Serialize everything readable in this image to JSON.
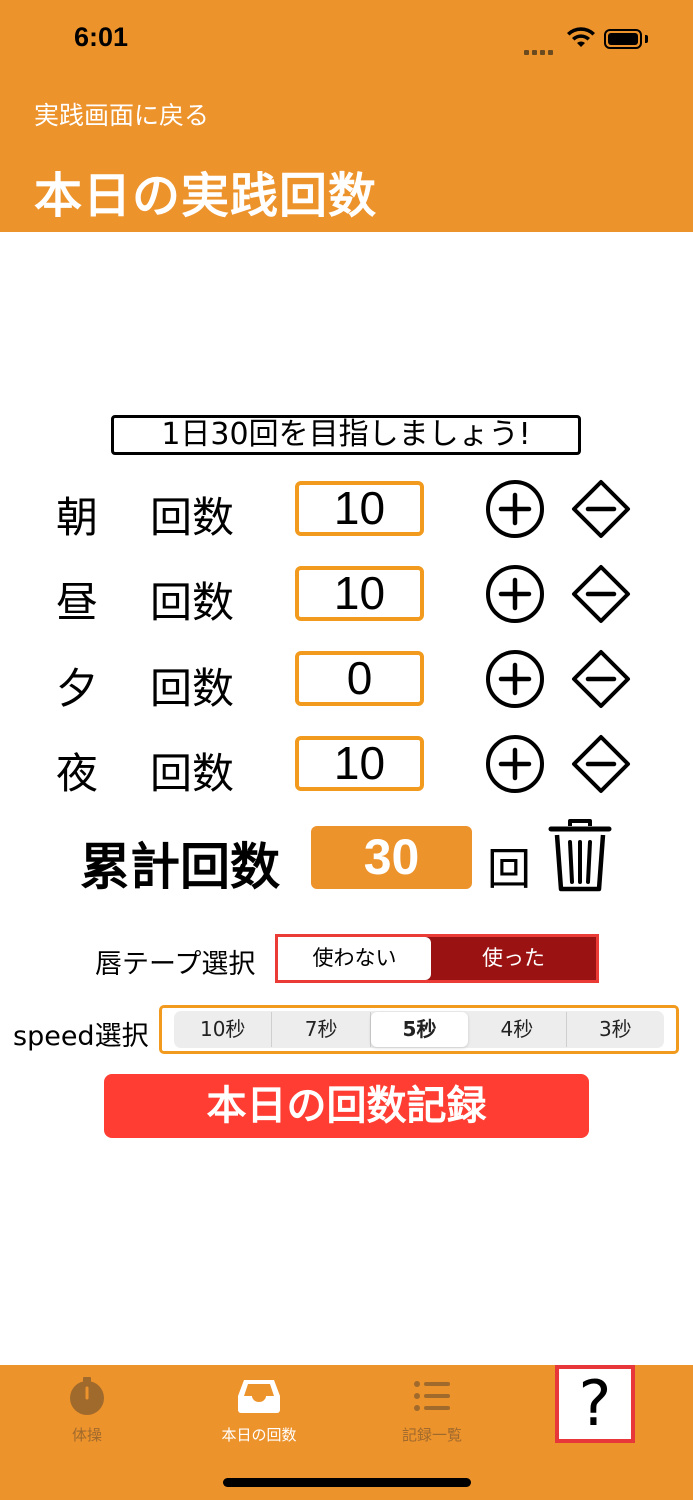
{
  "status_bar": {
    "time": "6:01"
  },
  "header": {
    "back_label": "実践画面に戻る",
    "title": "本日の実践回数"
  },
  "goal_text": "1日30回を目指しましょう!",
  "periods": [
    {
      "label": "朝",
      "count_label": "回数",
      "value": "10"
    },
    {
      "label": "昼",
      "count_label": "回数",
      "value": "10"
    },
    {
      "label": "夕",
      "count_label": "回数",
      "value": "0"
    },
    {
      "label": "夜",
      "count_label": "回数",
      "value": "10"
    }
  ],
  "total": {
    "label": "累計回数",
    "value": "30",
    "unit": "回"
  },
  "tape": {
    "label": "唇テープ選択",
    "options": [
      "使わない",
      "使った"
    ],
    "selected": "使わない"
  },
  "speed": {
    "label": "speed選択",
    "options": [
      "10秒",
      "7秒",
      "5秒",
      "4秒",
      "3秒"
    ],
    "selected": "5秒"
  },
  "record_button": "本日の回数記録",
  "tabbar": {
    "tabs": [
      {
        "label": "体操",
        "icon": "stopwatch-icon",
        "color": "#a06a2c"
      },
      {
        "label": "本日の回数",
        "icon": "inbox-tray-icon",
        "color": "#ffffff"
      },
      {
        "label": "記録一覧",
        "icon": "list-icon",
        "color": "#a06a2c"
      }
    ],
    "help_label": "?"
  },
  "colors": {
    "accent": "#ED932C",
    "record": "#FF3D33",
    "selected_tape": "#9A1212"
  }
}
